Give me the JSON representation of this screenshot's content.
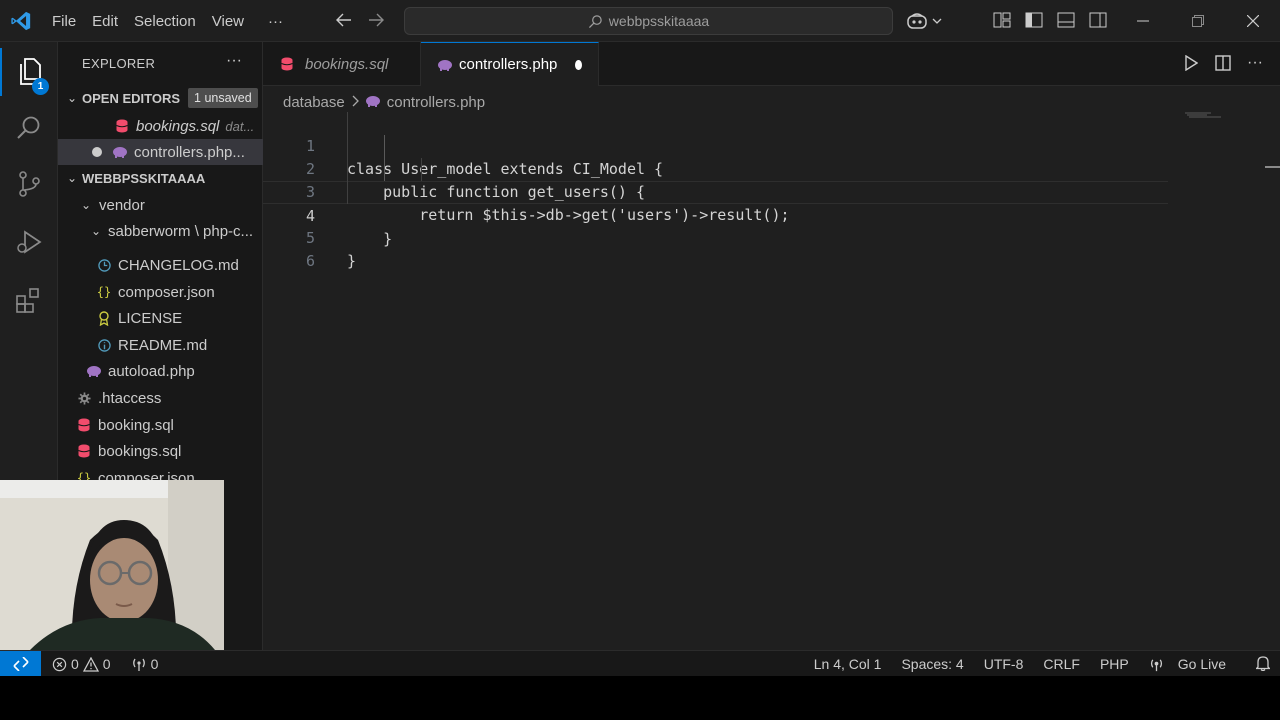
{
  "window": {
    "menu": [
      "File",
      "Edit",
      "Selection",
      "View"
    ],
    "more": "···",
    "search_text": "webbpsskitaaaa"
  },
  "activity": {
    "explorer_badge": "1"
  },
  "sidebar": {
    "title": "EXPLORER",
    "more": "···",
    "open_editors": {
      "label": "OPEN EDITORS",
      "badge": "1 unsaved",
      "items": [
        {
          "name": "bookings.sql",
          "desc": "dat..."
        },
        {
          "name": "controllers.php..."
        }
      ]
    },
    "folder": {
      "label": "WEBBPSSKITAAAA",
      "items": [
        {
          "name": "vendor"
        },
        {
          "name": "sabberworm \\ php-c..."
        },
        {
          "name": "CHANGELOG.md"
        },
        {
          "name": "composer.json"
        },
        {
          "name": "LICENSE"
        },
        {
          "name": "README.md"
        },
        {
          "name": "autoload.php"
        },
        {
          "name": ".htaccess"
        },
        {
          "name": "booking.sql"
        },
        {
          "name": "bookings.sql"
        },
        {
          "name": "composer.json"
        }
      ]
    }
  },
  "tabs": [
    {
      "label": "bookings.sql"
    },
    {
      "label": "controllers.php"
    }
  ],
  "breadcrumb": {
    "folder": "database",
    "file": "controllers.php"
  },
  "code": {
    "lines": [
      {
        "num": "1",
        "text": "class User_model extends CI_Model {"
      },
      {
        "num": "2",
        "text": "    public function get_users() {"
      },
      {
        "num": "3",
        "text": "        return $this->db->get('users')->result();"
      },
      {
        "num": "4",
        "text": "    }"
      },
      {
        "num": "5",
        "text": "}"
      },
      {
        "num": "6",
        "text": ""
      }
    ]
  },
  "statusbar": {
    "errors": "0",
    "warnings": "0",
    "ports": "0",
    "position": "Ln 4, Col 1",
    "spaces": "Spaces: 4",
    "encoding": "UTF-8",
    "eol": "CRLF",
    "language": "PHP",
    "golive": "Go Live"
  },
  "colors": {
    "accent": "#0078d4",
    "sql_icon": "#f14c6c",
    "php_icon": "#a074c4",
    "json_icon": "#cbcb41",
    "info_icon": "#519aba"
  }
}
